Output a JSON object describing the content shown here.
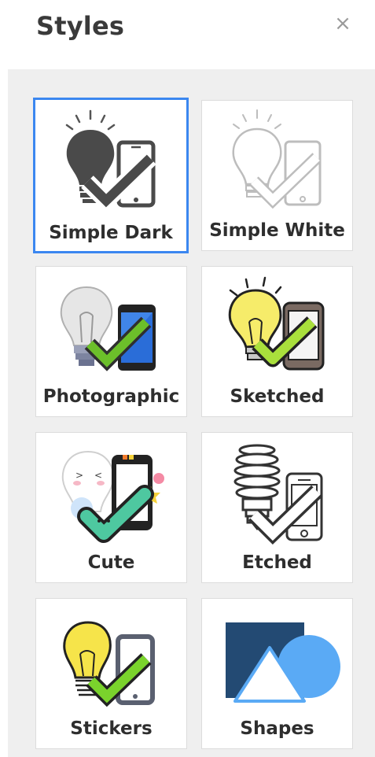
{
  "header": {
    "title": "Styles",
    "close_glyph": "×"
  },
  "accent_color": "#3b87f0",
  "styles": [
    {
      "label": "Simple Dark",
      "icon": "simple-dark-icon",
      "selected": true
    },
    {
      "label": "Simple White",
      "icon": "simple-white-icon",
      "selected": false
    },
    {
      "label": "Photographic",
      "icon": "photographic-icon",
      "selected": false
    },
    {
      "label": "Sketched",
      "icon": "sketched-icon",
      "selected": false
    },
    {
      "label": "Cute",
      "icon": "cute-icon",
      "selected": false
    },
    {
      "label": "Etched",
      "icon": "etched-icon",
      "selected": false
    },
    {
      "label": "Stickers",
      "icon": "stickers-icon",
      "selected": false
    },
    {
      "label": "Shapes",
      "icon": "shapes-icon",
      "selected": false
    }
  ]
}
